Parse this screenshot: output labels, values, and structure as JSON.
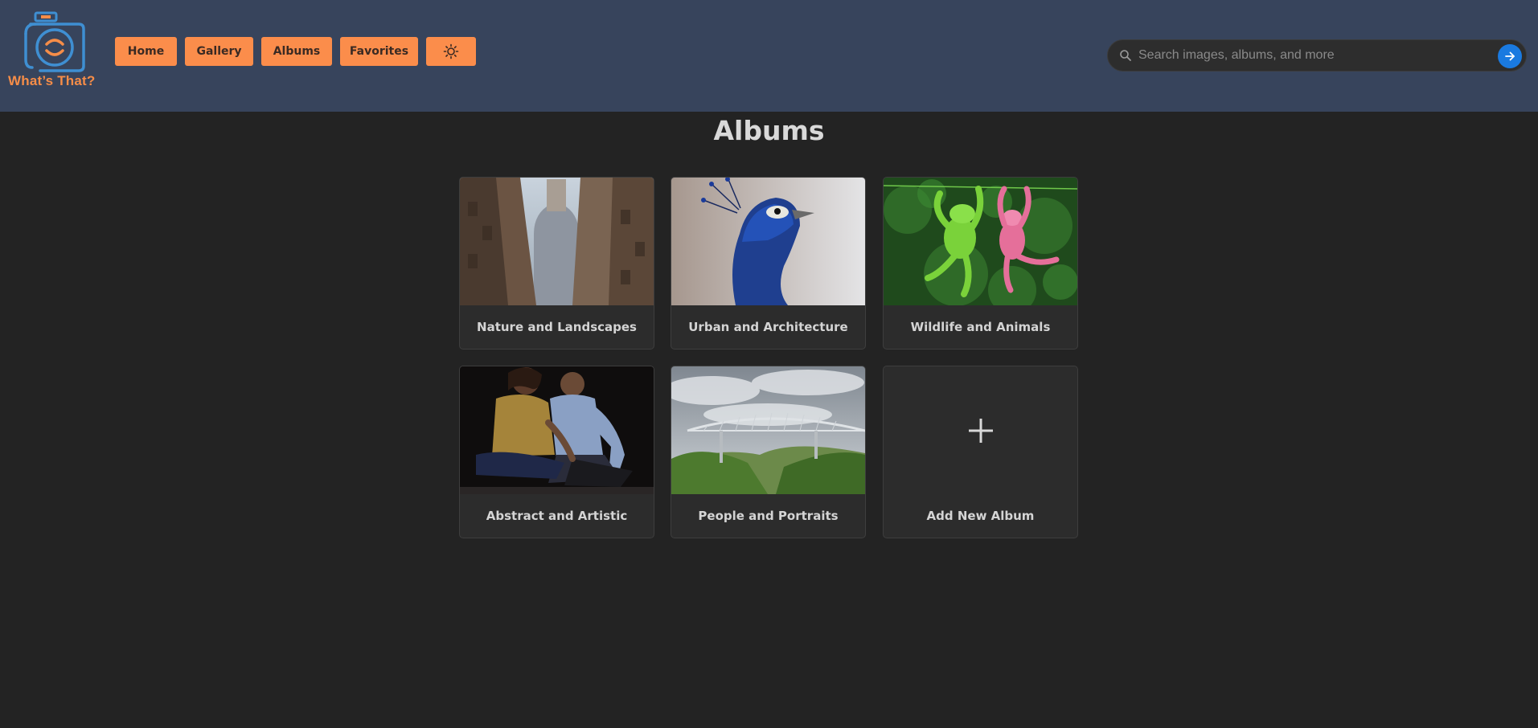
{
  "app": {
    "logo_text": "What’s That?"
  },
  "nav": {
    "home": "Home",
    "gallery": "Gallery",
    "albums": "Albums",
    "favorites": "Favorites",
    "theme_icon": "sun-icon"
  },
  "search": {
    "placeholder": "Search images, albums, and more",
    "value": "",
    "submit_icon": "arrow-right-icon"
  },
  "main": {
    "title": "Albums",
    "albums": [
      {
        "label": "Nature and Landscapes"
      },
      {
        "label": "Urban and Architecture"
      },
      {
        "label": "Wildlife and Animals"
      },
      {
        "label": "Abstract and Artistic"
      },
      {
        "label": "People and Portraits"
      }
    ],
    "add_album": {
      "label": "Add New Album",
      "icon": "plus-icon"
    }
  },
  "colors": {
    "header_bg": "#37445c",
    "page_bg": "#232323",
    "accent": "#fb8d4b",
    "logo_blue": "#3f8fd2",
    "search_button": "#1a7ae0"
  }
}
